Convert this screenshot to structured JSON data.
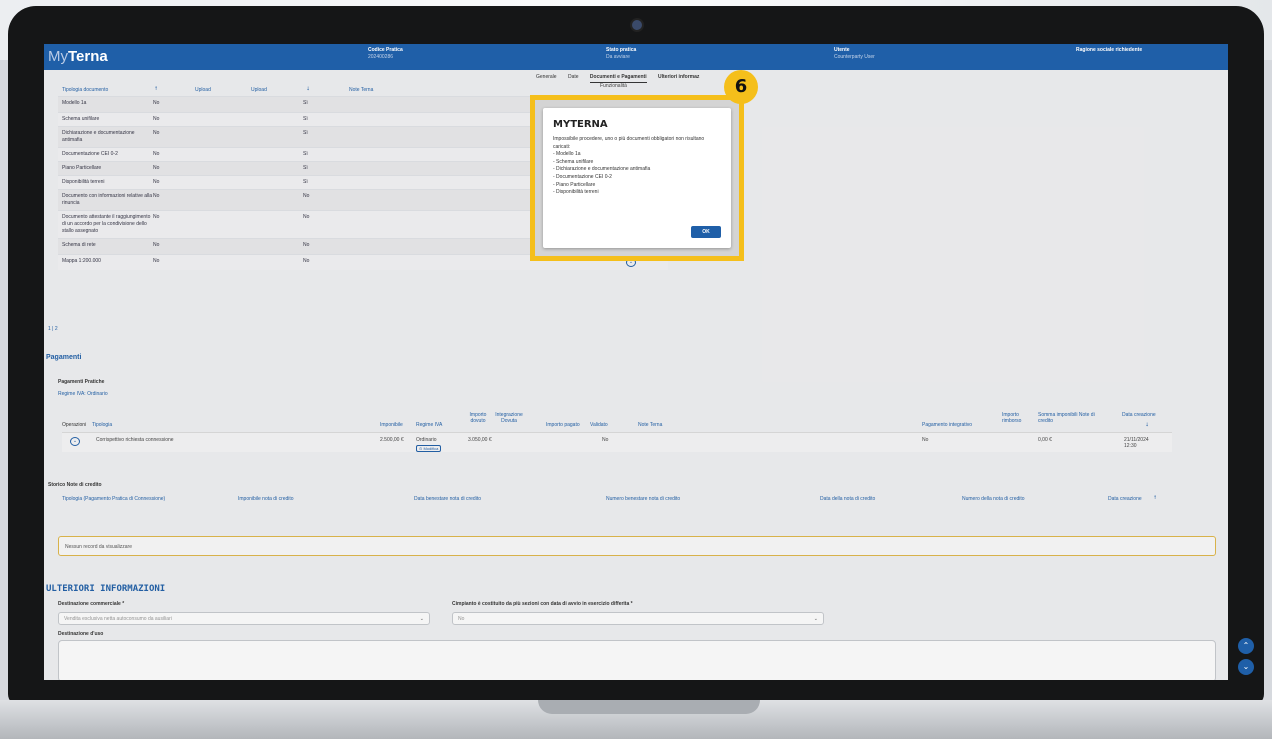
{
  "app": {
    "logo_prefix": "My",
    "logo_name": "Terna"
  },
  "header": {
    "codice_label": "Codice Pratica",
    "codice_value": "202400286",
    "stato_label": "Stato pratica",
    "stato_value": "Da avviare",
    "utente_label": "Utente",
    "utente_value": "Counterparty User",
    "ragione_label": "Ragione sociale richiedente"
  },
  "tabs": [
    "Generale",
    "Date",
    "Documenti e Pagamenti",
    "Ulteriori informaz"
  ],
  "funzionalita": "Funzionalità",
  "docs": {
    "headers": [
      "Tipologia documento",
      "Upload",
      "Upload",
      "Note Terna"
    ],
    "rows": [
      {
        "name": "Modello 1a",
        "flag1": "No",
        "flag2": "Sì"
      },
      {
        "name": "Schema unifilare",
        "flag1": "No",
        "flag2": "Sì"
      },
      {
        "name": "Dichiarazione e documentazione antimafia",
        "flag1": "No",
        "flag2": "Sì"
      },
      {
        "name": "Documentazione CEI 0-2",
        "flag1": "No",
        "flag2": "Sì"
      },
      {
        "name": "Piano Particellare",
        "flag1": "No",
        "flag2": "Sì"
      },
      {
        "name": "Disponibilità terreni",
        "flag1": "No",
        "flag2": "Sì"
      },
      {
        "name": "Documento con informazioni relative alla rinuncia",
        "flag1": "No",
        "flag2": "No"
      },
      {
        "name": "Documento attestante il raggiungimento di un accordo per la condivisione dello stallo assegnato",
        "flag1": "No",
        "flag2": "No"
      },
      {
        "name": "Schema di rete",
        "flag1": "No",
        "flag2": "No"
      },
      {
        "name": "Mappa 1:200.000",
        "flag1": "No",
        "flag2": "No"
      }
    ]
  },
  "pager": "1 | 2",
  "pagamenti": {
    "title": "Pagamenti",
    "subtitle": "Pagamenti Pratiche",
    "regime_link": "Regime IVA: Ordinario",
    "headers": {
      "operazioni": "Operazioni",
      "tipologia": "Tipologia",
      "imponibile": "Imponibile",
      "regime": "Regime IVA",
      "importo_dovuto": "Importo dovuto",
      "integrazione": "Integrazione Dovuta",
      "importo_pagato": "Importo pagato",
      "validato": "Validato",
      "note": "Note Terna",
      "pag_integrativo": "Pagamento integrativo",
      "importo_rimborso": "Importo rimborso",
      "somma": "Somma imponibili Note di credito",
      "data": "Data creazione"
    },
    "row": {
      "tipologia": "Corrispettivo richiesta connessione",
      "imponibile": "2.500,00 €",
      "regime": "Ordinario",
      "modifica": "Modifica",
      "importo_dovuto": "3.050,00 €",
      "validato": "No",
      "pag_integrativo": "No",
      "somma": "0,00 €",
      "data": "21/11/2024 12:30"
    }
  },
  "storico": {
    "title": "Storico Note di credito",
    "headers": [
      "Tipologia (Pagamento Pratica di Connessione)",
      "Imponibile nota di credito",
      "Data benestare nota di credito",
      "Numero benestare nota di credito",
      "Data della nota di credito",
      "Numero della nota di credito",
      "Data creazione"
    ],
    "empty": "Nessun record da visualizzare"
  },
  "ulteriori": {
    "title": "ULTERIORI INFORMAZIONI",
    "dest_label": "Destinazione commerciale *",
    "dest_value": "Vendita esclusiva netta autoconsumo da ausiliari",
    "impianto_label": "Cimpianto è costituito da più sezioni con data di avvio in esercizio differita *",
    "impianto_value": "No",
    "uso_label": "Destinazione d'uso"
  },
  "modal": {
    "title": "MYTERNA",
    "intro": "Impossibile procedere, uno o più documenti obbligatori non risultano caricati:",
    "items": [
      "- Modello 1a",
      "- Schema unifilare",
      "- Dichiarazione e documentazione antimafia",
      "- Documentazione CEI 0-2",
      "- Piano Particellare",
      "- Disponibilità terreni"
    ],
    "ok": "OK"
  },
  "step_badge": "6"
}
